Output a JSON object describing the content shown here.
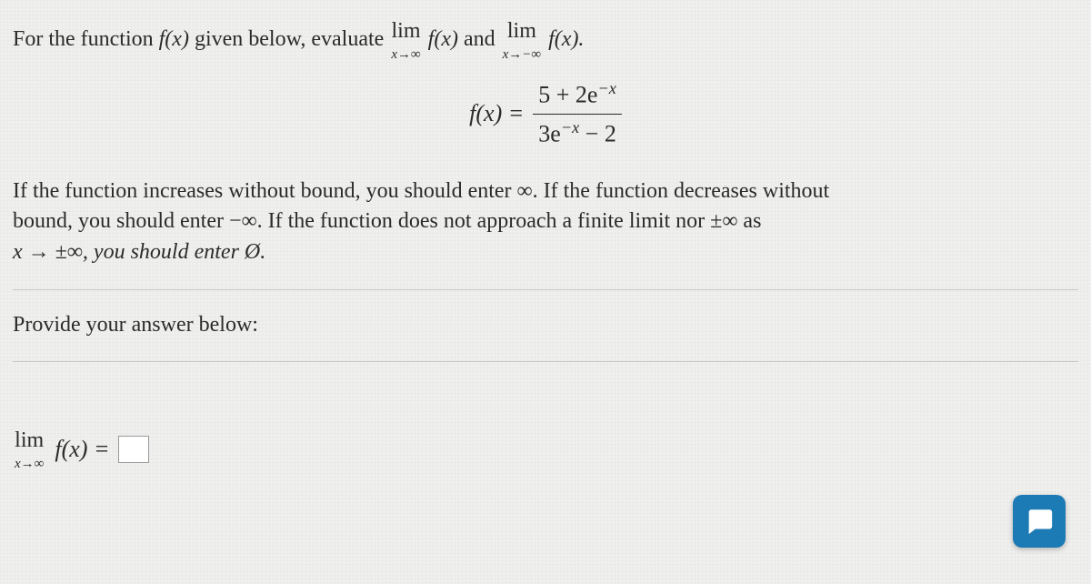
{
  "intro": {
    "p1": "For the function ",
    "fx": "f(x)",
    "p2": " given below, evaluate ",
    "lim_label": "lim",
    "lim1_sub": "x→∞",
    "fx1": "f(x)",
    "and": " and ",
    "lim2_sub": "x→−∞",
    "fx2": "f(x).",
    "period": ""
  },
  "equation": {
    "lhs": "f(x) =",
    "num_a": "5 + 2e",
    "num_exp": "−x",
    "den_a": "3e",
    "den_exp": "−x",
    "den_b": " − 2"
  },
  "hint": {
    "l1a": "If the function increases without bound, you should enter ∞. If the function decreases without",
    "l2a": "bound, you should enter −∞. If the function does not approach a finite limit nor ±∞ as",
    "l3a": "x → ±∞, you should enter Ø."
  },
  "answer": {
    "prompt": "Provide your answer below:",
    "lim_label": "lim",
    "lim_sub": "x→∞",
    "fx_eq": "f(x) =",
    "value": ""
  },
  "chat": {
    "name": "chat-button"
  }
}
